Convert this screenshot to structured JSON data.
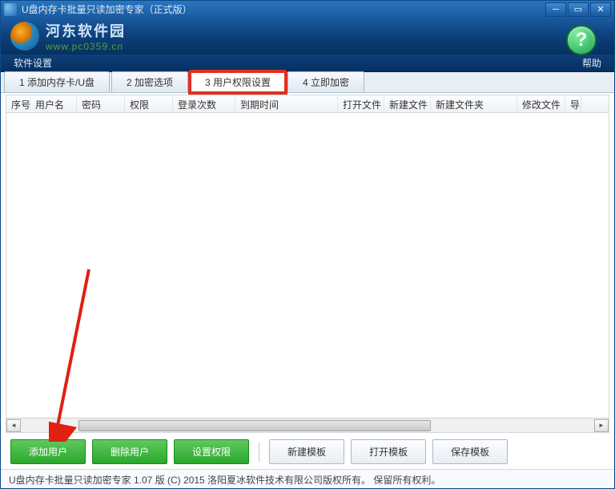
{
  "titlebar": {
    "title": "U盘内存卡批量只读加密专家（正式版）"
  },
  "logo": {
    "cn": "河东软件园",
    "url": "www.pc0359.cn"
  },
  "menu": {
    "settings": "软件设置",
    "help": "帮助"
  },
  "tabs": [
    {
      "label": "1 添加内存卡/U盘"
    },
    {
      "label": "2 加密选项"
    },
    {
      "label": "3 用户权限设置"
    },
    {
      "label": "4 立即加密"
    }
  ],
  "columns": {
    "seq": "序号",
    "username": "用户名",
    "password": "密码",
    "permission": "权限",
    "logins": "登录次数",
    "expire": "到期时间",
    "openfile": "打开文件",
    "newfile": "新建文件",
    "newfolder": "新建文件夹",
    "editfile": "修改文件",
    "export": "导"
  },
  "buttons": {
    "add_user": "添加用户",
    "del_user": "删除用户",
    "set_perm": "设置权限",
    "new_tpl": "新建模板",
    "open_tpl": "打开模板",
    "save_tpl": "保存模板"
  },
  "status": "U盘内存卡批量只读加密专家 1.07 版  (C) 2015 洛阳夏冰软件技术有限公司版权所有。 保留所有权利。"
}
